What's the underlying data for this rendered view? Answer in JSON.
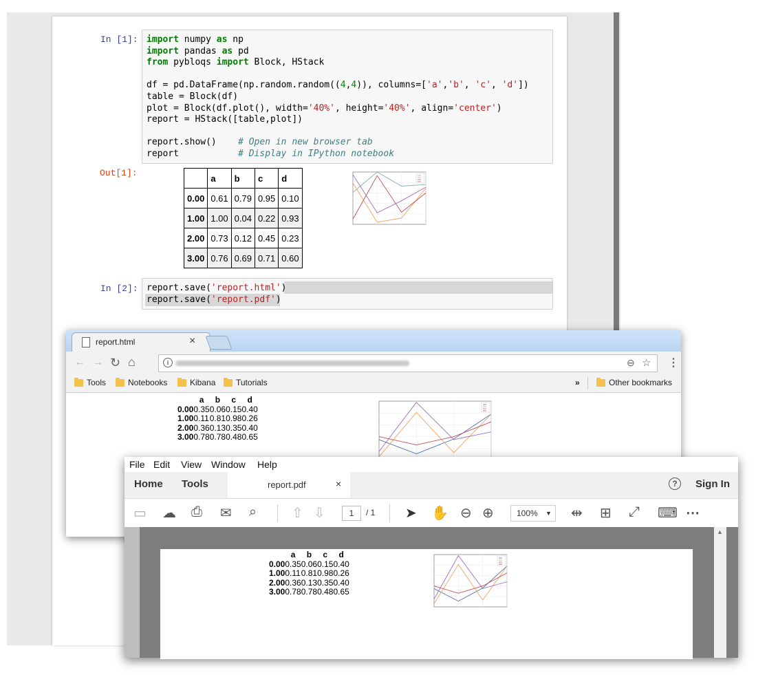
{
  "notebook": {
    "cell1": {
      "prompt": "In [1]:",
      "lines": [
        [
          {
            "t": "import",
            "c": "kw"
          },
          {
            "t": " numpy "
          },
          {
            "t": "as",
            "c": "kw"
          },
          {
            "t": " np"
          }
        ],
        [
          {
            "t": "import",
            "c": "kw"
          },
          {
            "t": " pandas "
          },
          {
            "t": "as",
            "c": "kw"
          },
          {
            "t": " pd"
          }
        ],
        [
          {
            "t": "from",
            "c": "kw"
          },
          {
            "t": " pybloqs "
          },
          {
            "t": "import",
            "c": "kw"
          },
          {
            "t": " Block, HStack"
          }
        ],
        [],
        [
          {
            "t": "df = pd.DataFrame(np.random.random(("
          },
          {
            "t": "4",
            "c": "num"
          },
          {
            "t": ","
          },
          {
            "t": "4",
            "c": "num"
          },
          {
            "t": ")), columns=["
          },
          {
            "t": "'a'",
            "c": "str"
          },
          {
            "t": ","
          },
          {
            "t": "'b'",
            "c": "str"
          },
          {
            "t": ", "
          },
          {
            "t": "'c'",
            "c": "str"
          },
          {
            "t": ", "
          },
          {
            "t": "'d'",
            "c": "str"
          },
          {
            "t": "])"
          }
        ],
        [
          {
            "t": "table = Block(df)"
          }
        ],
        [
          {
            "t": "plot = Block(df.plot(), width="
          },
          {
            "t": "'40%'",
            "c": "str"
          },
          {
            "t": ", height="
          },
          {
            "t": "'40%'",
            "c": "str"
          },
          {
            "t": ", align="
          },
          {
            "t": "'center'",
            "c": "str"
          },
          {
            "t": ")"
          }
        ],
        [
          {
            "t": "report = HStack([table,plot])"
          }
        ],
        [],
        [
          {
            "t": "report.show()    "
          },
          {
            "t": "# Open in new browser tab",
            "c": "cm"
          }
        ],
        [
          {
            "t": "report           "
          },
          {
            "t": "# Display in IPython notebook",
            "c": "cm"
          }
        ]
      ]
    },
    "out1": {
      "prompt": "Out[1]:",
      "columns": [
        "a",
        "b",
        "c",
        "d"
      ],
      "rows": [
        {
          "index": "0.00",
          "values": [
            "0.61",
            "0.79",
            "0.95",
            "0.10"
          ]
        },
        {
          "index": "1.00",
          "values": [
            "1.00",
            "0.04",
            "0.22",
            "0.93"
          ]
        },
        {
          "index": "2.00",
          "values": [
            "0.73",
            "0.12",
            "0.45",
            "0.23"
          ]
        },
        {
          "index": "3.00",
          "values": [
            "0.76",
            "0.69",
            "0.71",
            "0.60"
          ]
        }
      ]
    },
    "cell2": {
      "prompt": "In [2]:",
      "lines": [
        [
          {
            "t": "report.save("
          },
          {
            "t": "'report.html'",
            "c": "str"
          },
          {
            "t": ")"
          }
        ],
        [
          {
            "t": "report.save("
          },
          {
            "t": "'report.pdf'",
            "c": "str"
          },
          {
            "t": ")"
          }
        ]
      ]
    }
  },
  "browser": {
    "tab_title": "report.html",
    "tab_close": "×",
    "bookmarks": [
      "Tools",
      "Notebooks",
      "Kibana",
      "Tutorials"
    ],
    "bookmarks_more": "»",
    "other_bookmarks": "Other bookmarks",
    "columns": [
      "a",
      "b",
      "c",
      "d"
    ],
    "rows": [
      {
        "index": "0.00",
        "values": [
          "0.35",
          "0.06",
          "0.15",
          "0.40"
        ]
      },
      {
        "index": "1.00",
        "values": [
          "0.11",
          "0.81",
          "0.98",
          "0.26"
        ]
      },
      {
        "index": "2.00",
        "values": [
          "0.36",
          "0.13",
          "0.35",
          "0.40"
        ]
      },
      {
        "index": "3.00",
        "values": [
          "0.78",
          "0.78",
          "0.48",
          "0.65"
        ]
      }
    ]
  },
  "pdf": {
    "menu": [
      "File",
      "Edit",
      "View",
      "Window",
      "Help"
    ],
    "tabs": {
      "home": "Home",
      "tools": "Tools",
      "doc": "report.pdf",
      "close": "×",
      "signin": "Sign In",
      "help": "?"
    },
    "page_current": "1",
    "page_total": "/ 1",
    "zoom": "100%"
  },
  "colors": {
    "series_a": "#4c72b0",
    "series_b": "#f0a35e",
    "series_c": "#9a6fbf",
    "series_d": "#c44e52",
    "series_e": "#7fb3b0"
  }
}
